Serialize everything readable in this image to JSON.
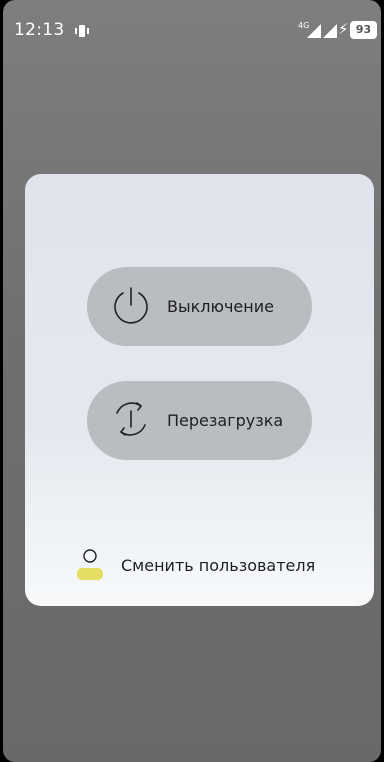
{
  "statusbar": {
    "time": "12:13",
    "network_label": "4G",
    "battery": "93",
    "icons": [
      "vibrate-icon",
      "signal-icon",
      "signal-icon",
      "charging-icon",
      "battery-icon"
    ]
  },
  "power_menu": {
    "power_off_label": "Выключение",
    "restart_label": "Перезагрузка",
    "switch_user_label": "Сменить пользователя"
  },
  "colors": {
    "panel_background": "#e4e8ee",
    "button_background": "#b9bcc1",
    "user_accent": "#e3de62"
  }
}
